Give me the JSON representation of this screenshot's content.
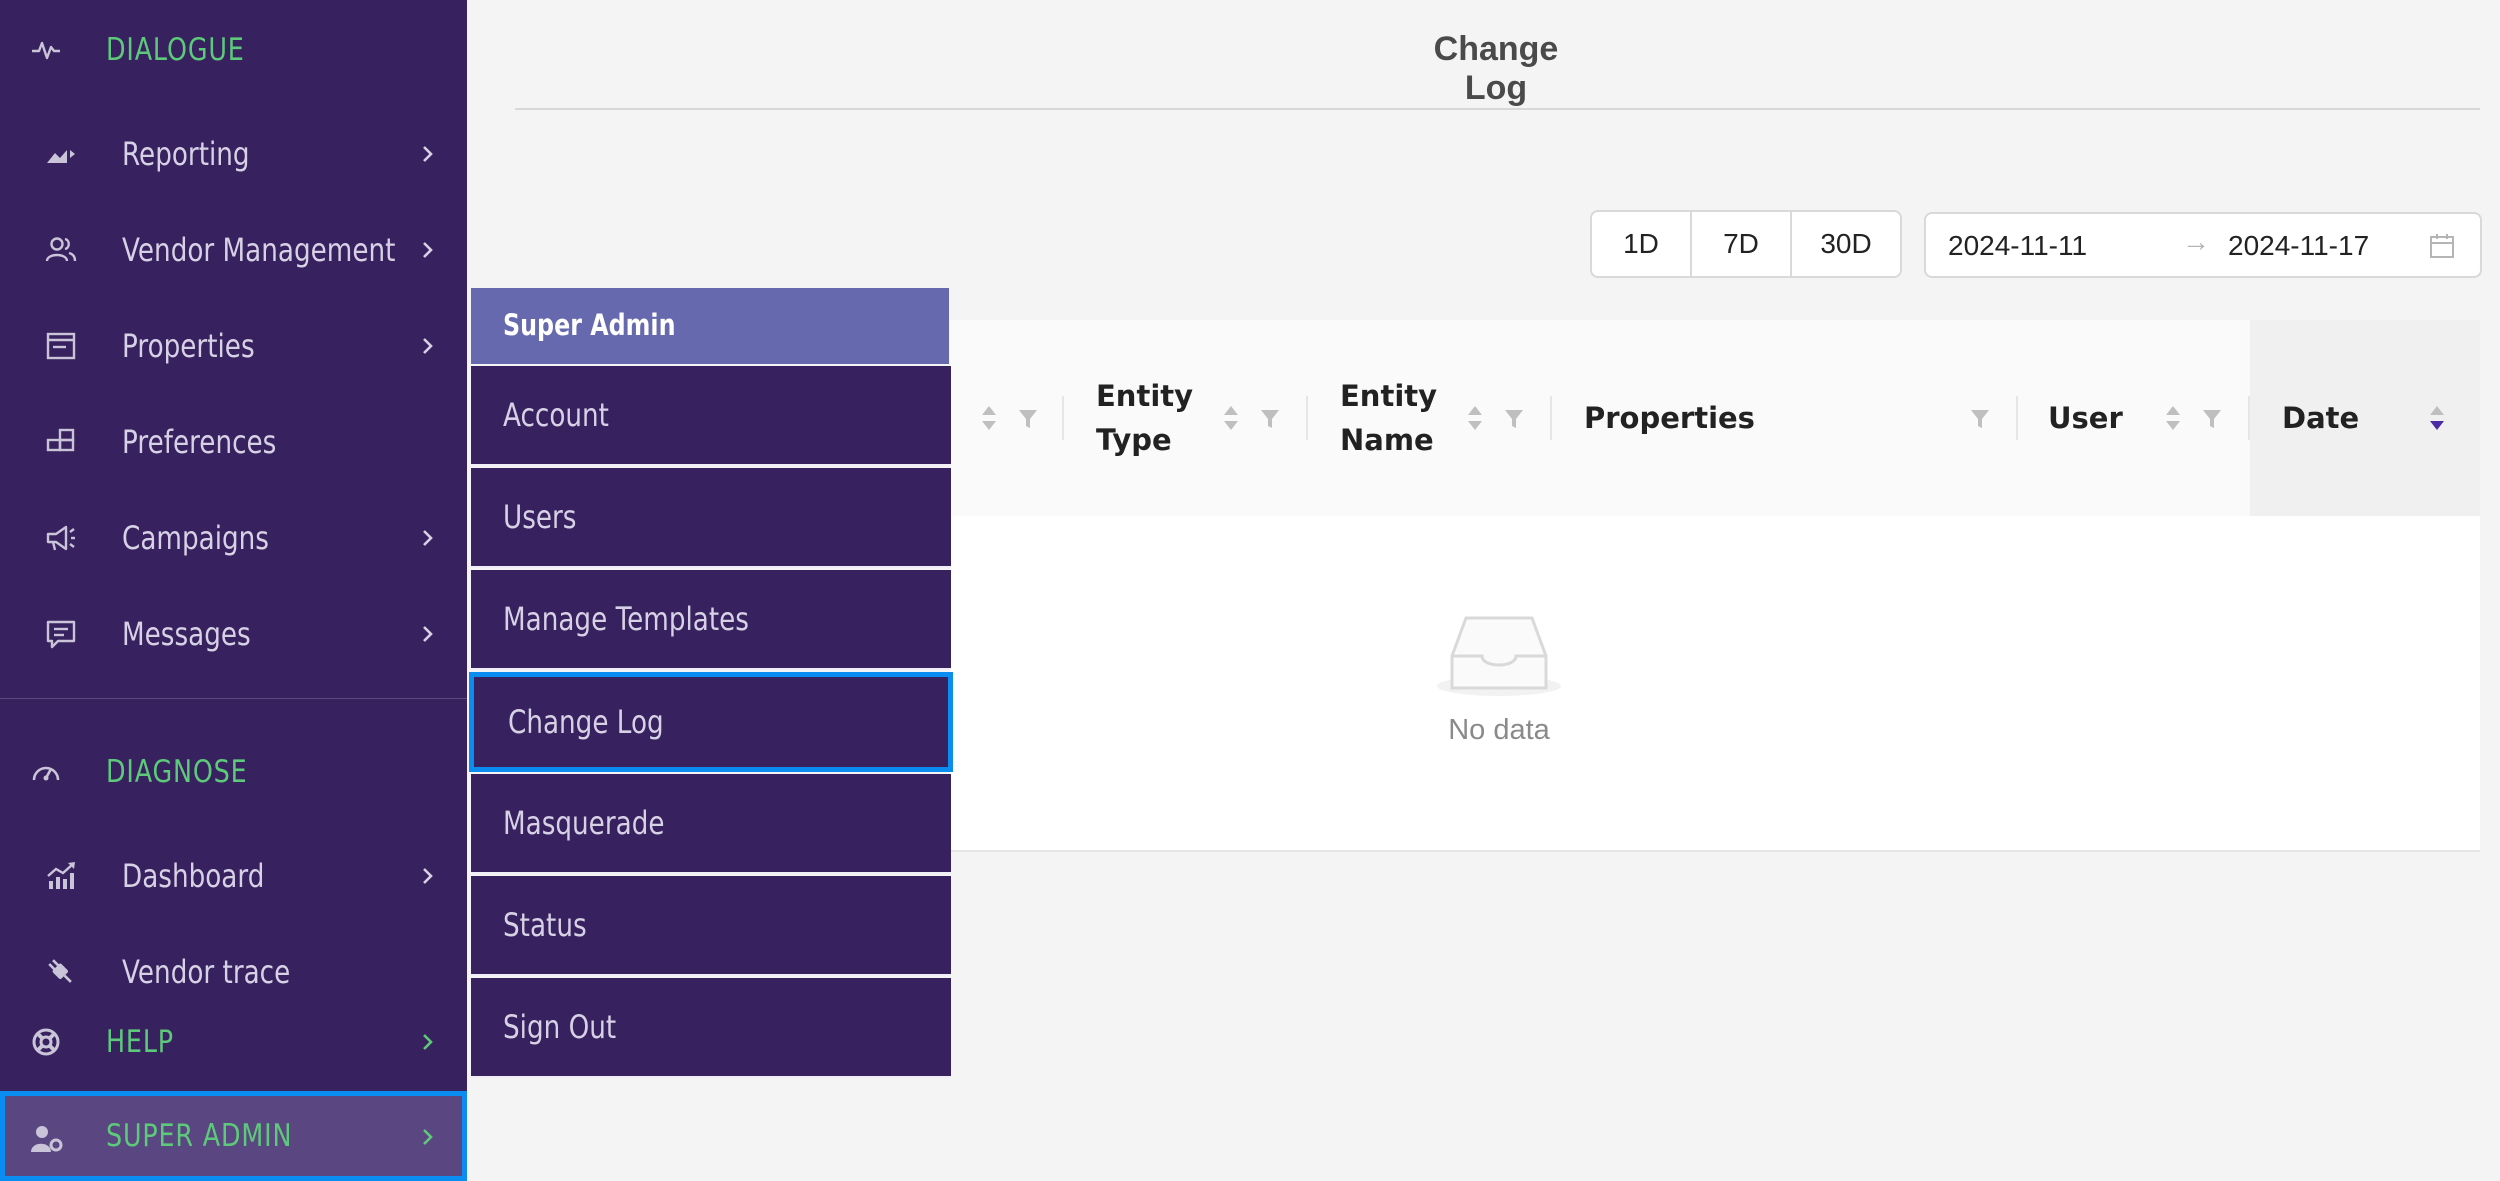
{
  "sidebar": {
    "sections": {
      "dialogue": "DIALOGUE",
      "diagnose": "DIAGNOSE",
      "help": "HELP",
      "super_admin": "SUPER ADMIN"
    },
    "dialogue_items": [
      {
        "label": "Reporting",
        "icon": "reporting-icon",
        "has_submenu": true
      },
      {
        "label": "Vendor Management",
        "icon": "users-icon",
        "has_submenu": true
      },
      {
        "label": "Properties",
        "icon": "properties-icon",
        "has_submenu": true
      },
      {
        "label": "Preferences",
        "icon": "preferences-icon",
        "has_submenu": false
      },
      {
        "label": "Campaigns",
        "icon": "megaphone-icon",
        "has_submenu": true
      },
      {
        "label": "Messages",
        "icon": "message-icon",
        "has_submenu": true
      }
    ],
    "diagnose_items": [
      {
        "label": "Dashboard",
        "icon": "chart-icon",
        "has_submenu": true
      },
      {
        "label": "Vendor trace",
        "icon": "plug-icon",
        "has_submenu": false
      }
    ]
  },
  "flyout": {
    "header": "Super Admin",
    "items": [
      "Account",
      "Users",
      "Manage Templates",
      "Change Log",
      "Masquerade",
      "Status",
      "Sign Out"
    ],
    "active": "Change Log"
  },
  "main": {
    "title": "Change Log",
    "ranges": [
      "1D",
      "7D",
      "30D"
    ],
    "date_start": "2024-11-11",
    "date_end": "2024-11-17",
    "columns": {
      "entity_type_1": "Entity",
      "entity_type_2": "Type",
      "entity_name_1": "Entity",
      "entity_name_2": "Name",
      "properties": "Properties",
      "user": "User",
      "date": "Date"
    },
    "empty_text": "No data"
  },
  "colors": {
    "sidebar_bg": "#37215e",
    "section_green": "#5dc97a",
    "flyout_header": "#6669ae",
    "highlight_border": "#0a8cf0",
    "sort_active": "#4b2aa6"
  }
}
